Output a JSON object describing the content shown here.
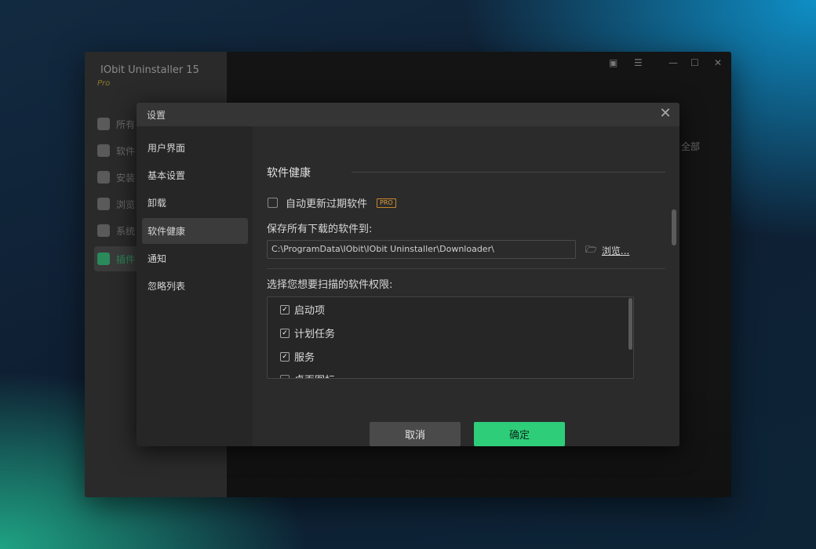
{
  "app": {
    "title": "IObit Uninstaller 15",
    "edition": "Pro",
    "nav": [
      {
        "label": "所有"
      },
      {
        "label": "软件"
      },
      {
        "label": "安装"
      },
      {
        "label": "浏览"
      },
      {
        "label": "系统"
      },
      {
        "label": "插件"
      }
    ],
    "bg_right_text": "全部"
  },
  "dialog": {
    "title": "设置",
    "close_icon": "close-icon",
    "sidebar": [
      {
        "label": "用户界面"
      },
      {
        "label": "基本设置"
      },
      {
        "label": "卸载"
      },
      {
        "label": "软件健康"
      },
      {
        "label": "通知"
      },
      {
        "label": "忽略列表"
      }
    ],
    "active_tab": "软件健康",
    "section_title": "软件健康",
    "auto_update": {
      "label": "自动更新过期软件",
      "checked": false,
      "badge": "PRO"
    },
    "save_label": "保存所有下载的软件到:",
    "save_path": "C:\\ProgramData\\IObit\\IObit Uninstaller\\Downloader\\",
    "browse_label": "浏览...",
    "scan_label": "选择您想要扫描的软件权限:",
    "permissions": [
      {
        "label": "启动项",
        "checked": true
      },
      {
        "label": "计划任务",
        "checked": true
      },
      {
        "label": "服务",
        "checked": true
      },
      {
        "label": "桌面图标",
        "checked": false
      }
    ],
    "cancel_label": "取消",
    "ok_label": "确定"
  },
  "colors": {
    "accent_green": "#2ecd7a",
    "pro_badge": "#e0a040",
    "dialog_bg": "#2b2b2b"
  }
}
